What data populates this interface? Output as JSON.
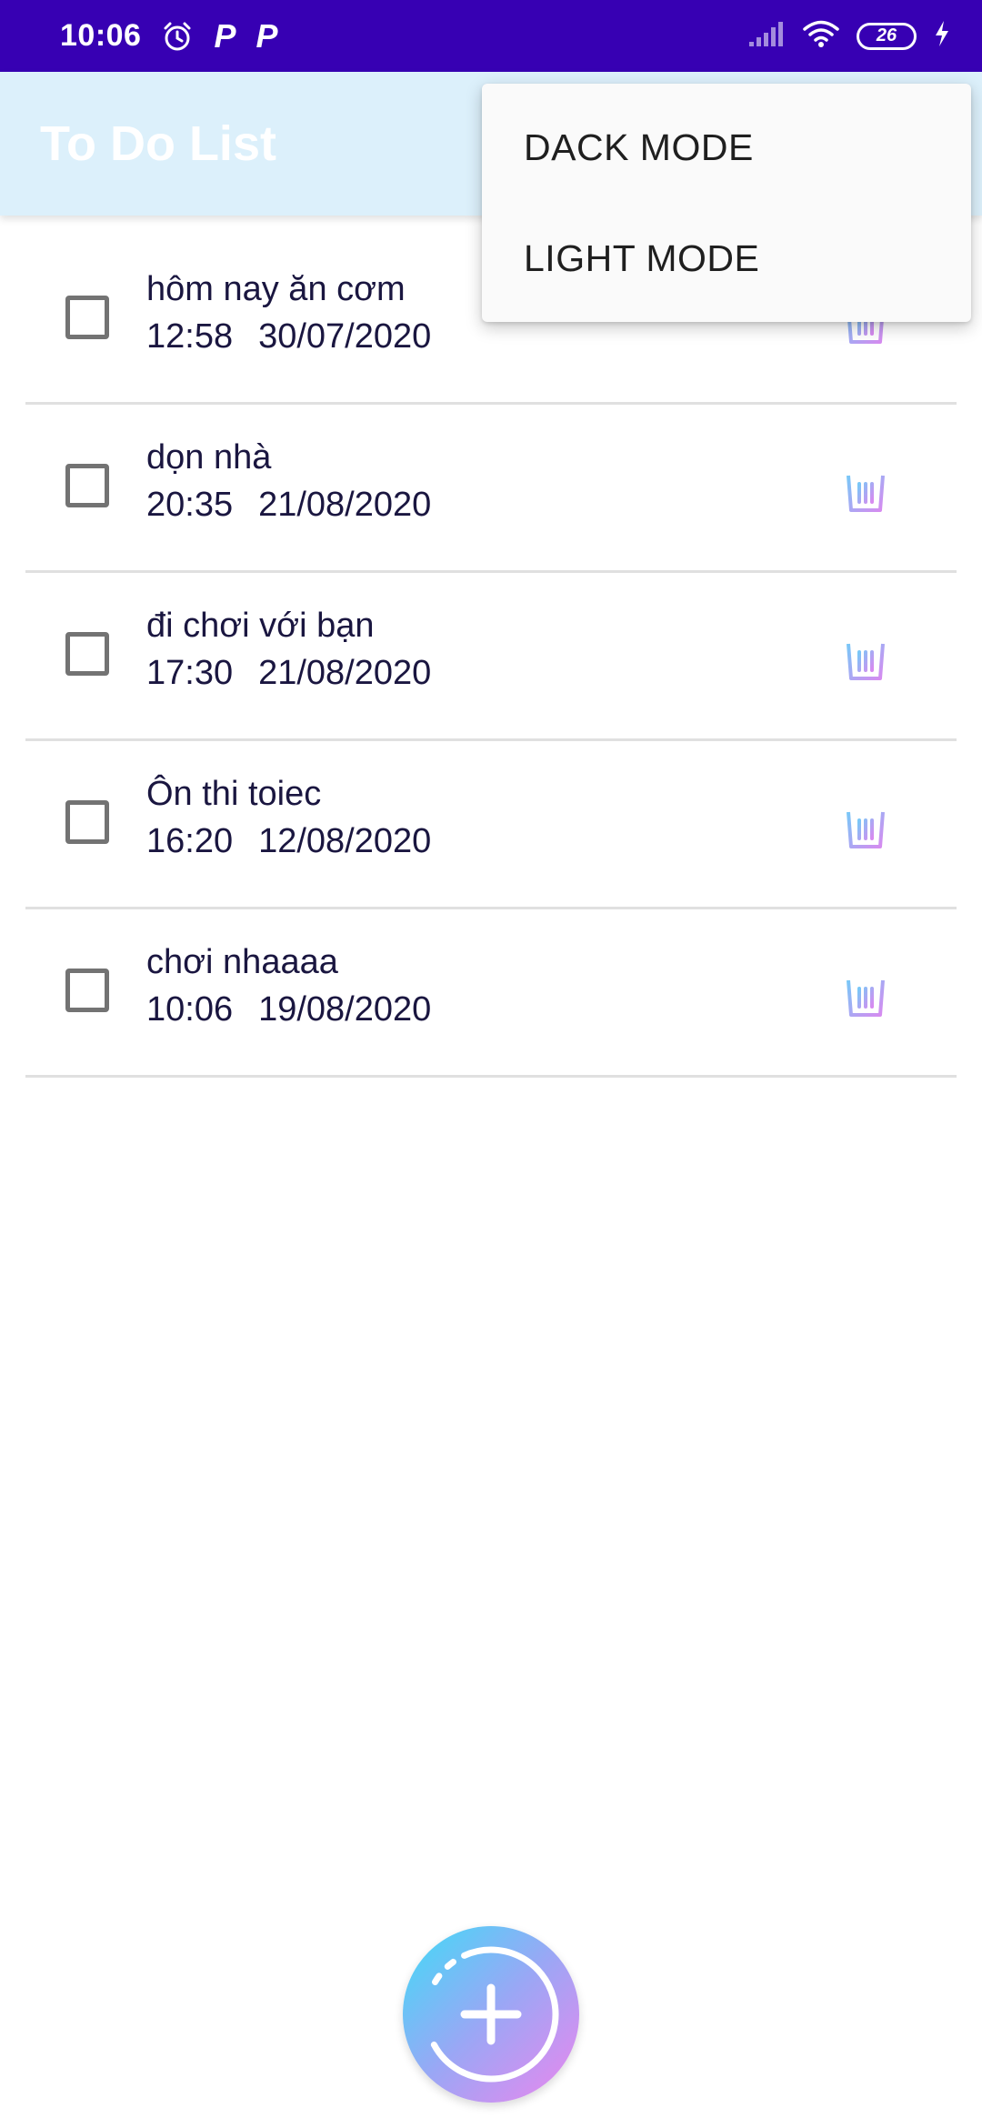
{
  "status_bar": {
    "time": "10:06",
    "battery": "26",
    "icons": [
      "alarm-icon",
      "parking-icon",
      "parking-icon",
      "signal-icon",
      "wifi-icon",
      "battery-icon",
      "charging-icon"
    ],
    "p_glyph": "P",
    "background": "#3700b3"
  },
  "app_bar": {
    "title": "To Do List",
    "background": "#dcf0fb"
  },
  "menu": {
    "items": [
      {
        "label": "DACK MODE"
      },
      {
        "label": "LIGHT MODE"
      }
    ]
  },
  "tasks": [
    {
      "title": "hôm nay ăn cơm",
      "time": "12:58",
      "date": "30/07/2020",
      "checked": false
    },
    {
      "title": "dọn nhà",
      "time": "20:35",
      "date": "21/08/2020",
      "checked": false
    },
    {
      "title": "đi chơi với bạn",
      "time": "17:30",
      "date": "21/08/2020",
      "checked": false
    },
    {
      "title": "Ôn thi toiec",
      "time": "16:20",
      "date": "12/08/2020",
      "checked": false
    },
    {
      "title": "chơi nhaaaa",
      "time": "10:06",
      "date": "19/08/2020",
      "checked": false
    }
  ],
  "icons": {
    "delete": "trash-icon",
    "fab": "plus-icon"
  },
  "colors": {
    "accent_start": "#3fdcf7",
    "accent_mid": "#9aa7f5",
    "accent_end": "#ec86ee",
    "text": "#1a1640",
    "checkbox": "#737373"
  }
}
